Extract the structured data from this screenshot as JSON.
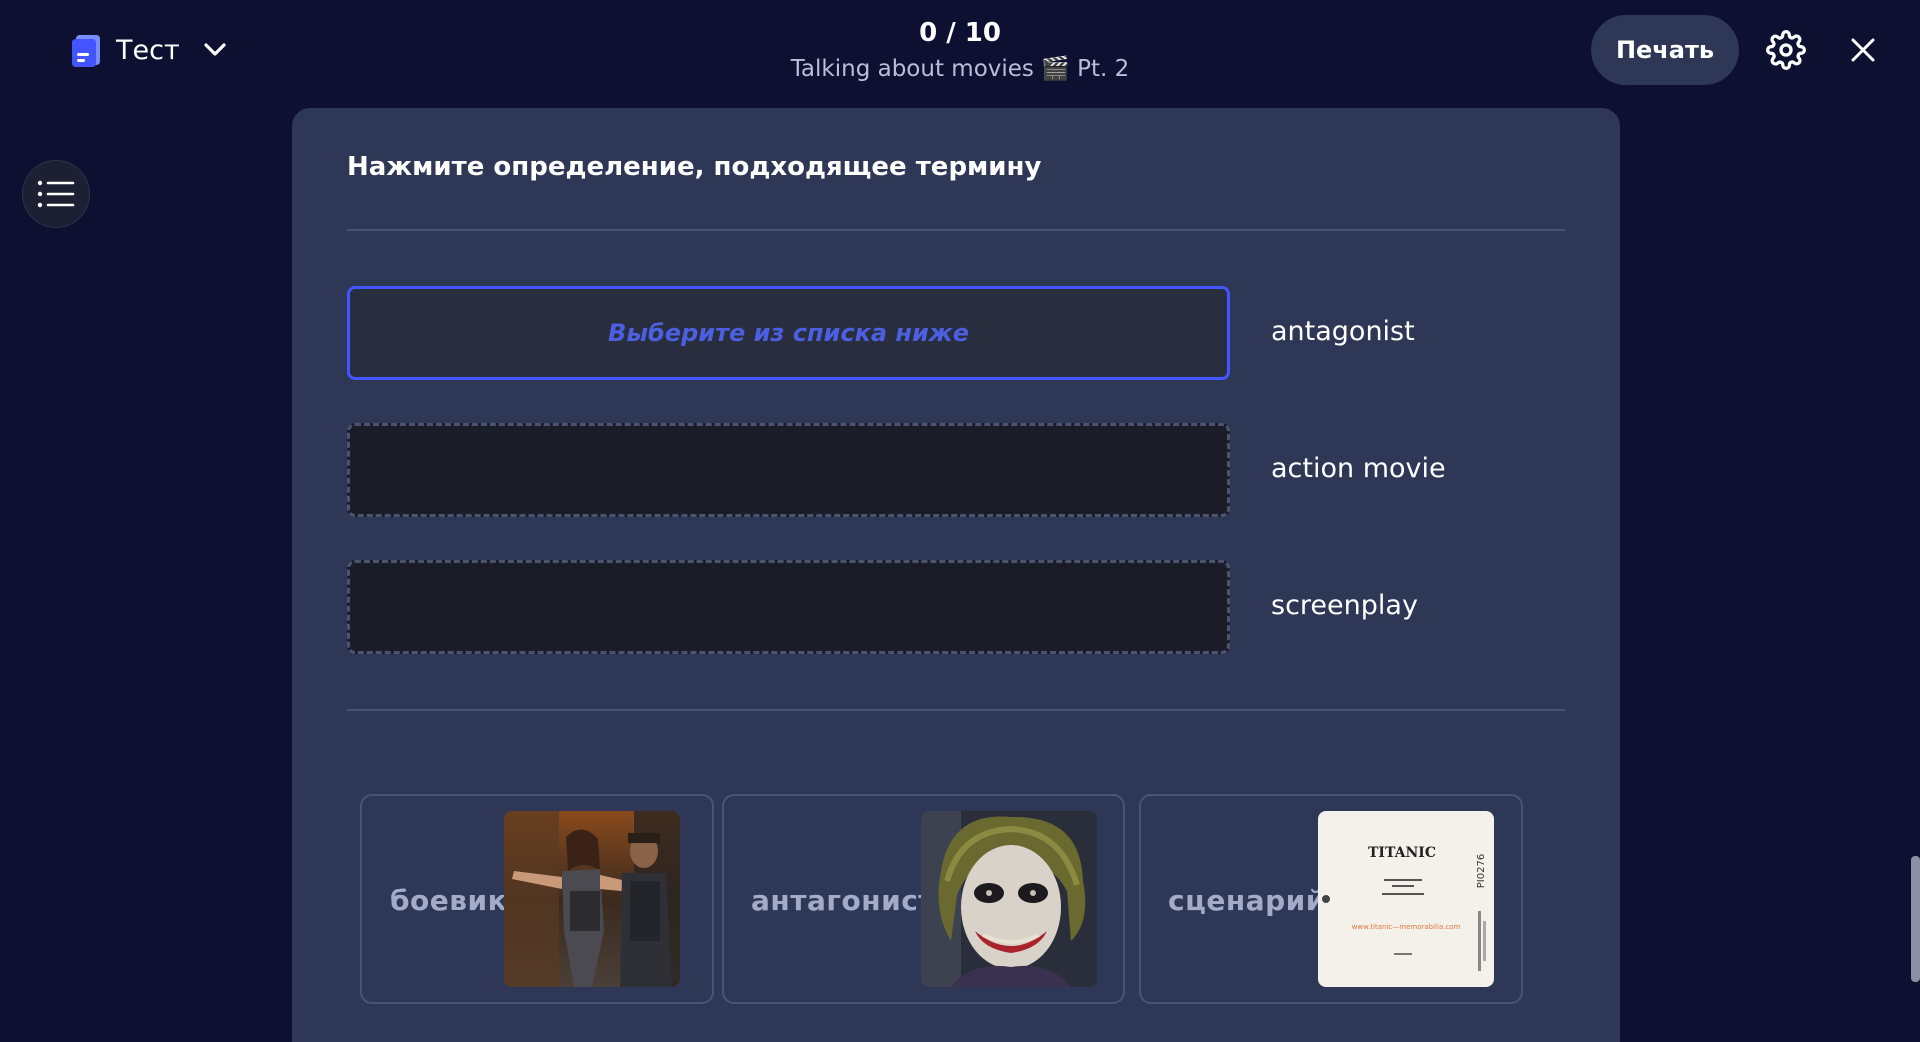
{
  "header": {
    "mode_label": "Тест",
    "progress": "0 / 10",
    "set_title": "Talking about movies 🎬 Pt. 2",
    "print_label": "Печать"
  },
  "question": {
    "prompt": "Нажмите определение, подходящее термину",
    "slot_hint": "Выберите из списка ниже",
    "terms": [
      "antagonist",
      "action movie",
      "screenplay"
    ]
  },
  "options": [
    {
      "label": "боевик",
      "image": "action-movie-still"
    },
    {
      "label": "антагонист",
      "image": "joker-portrait"
    },
    {
      "label": "сценарий",
      "image": "titanic-screenplay-cover"
    }
  ],
  "screenplay_cover": {
    "title": "TITANIC",
    "code": "PI0276",
    "url": "www.titanic—memorabilia.com"
  },
  "colors": {
    "background": "#0d1030",
    "card": "#2e3856",
    "accent": "#4255ff",
    "hint": "#4c5fe0"
  },
  "icons": [
    "study-set-icon",
    "chevron-down-icon",
    "gear-icon",
    "close-icon",
    "list-icon"
  ]
}
